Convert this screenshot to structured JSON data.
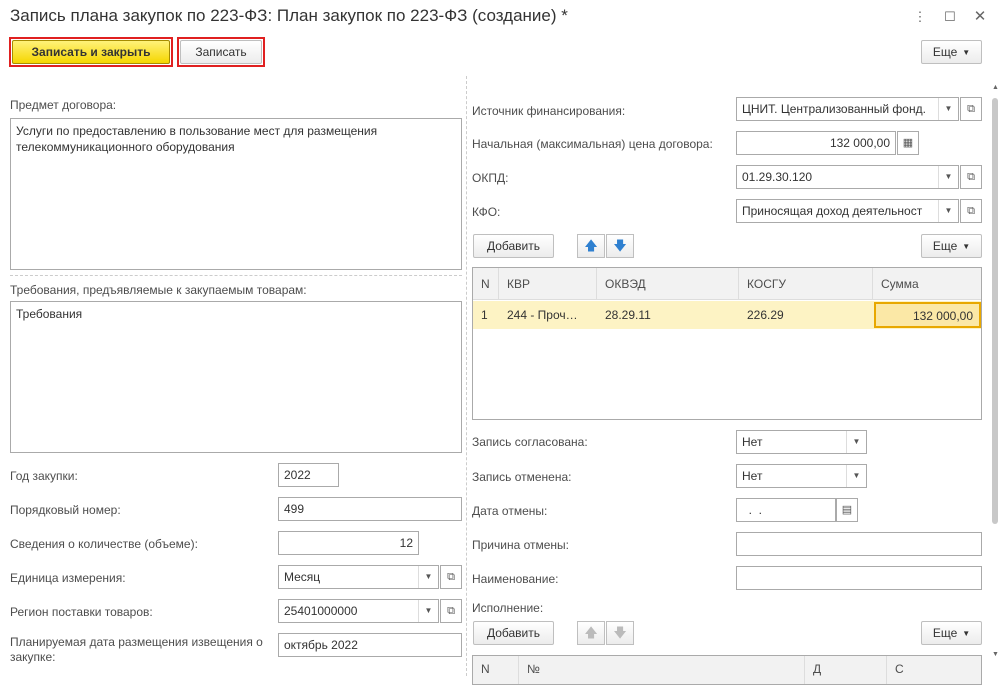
{
  "window": {
    "title": "Запись плана закупок по 223-ФЗ: План закупок по 223-ФЗ (создание) *"
  },
  "toolbar": {
    "save_close": "Записать и закрыть",
    "save": "Записать",
    "more": "Еще"
  },
  "left": {
    "subject_label": "Предмет договора:",
    "subject_value": "Услуги  по предоставлению в пользование мест для размещения телекоммуникационного оборудования",
    "requirements_label": "Требования, предъявляемые к закупаемым товарам:",
    "requirements_value": "Требования",
    "year_label": "Год закупки:",
    "year_value": "2022",
    "order_label": "Порядковый номер:",
    "order_value": "499",
    "quantity_label": "Сведения о количестве (объеме):",
    "quantity_value": "12",
    "unit_label": "Единица измерения:",
    "unit_value": "Месяц",
    "region_label": "Регион поставки товаров:",
    "region_value": "25401000000",
    "notice_date_label": "Планируемая дата размещения извещения о закупке:",
    "notice_date_value": "октябрь 2022"
  },
  "right": {
    "funding_label": "Источник финансирования:",
    "funding_value": "ЦНИТ. Централизованный фонд.",
    "price_label": "Начальная (максимальная) цена договора:",
    "price_value": "132 000,00",
    "okpd_label": "ОКПД:",
    "okpd_value": "01.29.30.120",
    "kfo_label": "КФО:",
    "kfo_value": "Приносящая доход деятельност",
    "add_label": "Добавить",
    "more_label": "Еще",
    "table": {
      "headers": [
        "N",
        "КВР",
        "ОКВЭД",
        "КОСГУ",
        "Сумма"
      ],
      "rows": [
        {
          "n": "1",
          "kvr": "244 - Проч…",
          "okved": "28.29.11",
          "kosgu": "226.29",
          "sum": "132 000,00"
        }
      ]
    },
    "agreed_label": "Запись согласована:",
    "agreed_value": "Нет",
    "cancelled_label": "Запись отменена:",
    "cancelled_value": "Нет",
    "cancel_date_label": "Дата отмены:",
    "cancel_date_value": "  .  .",
    "cancel_reason_label": "Причина отмены:",
    "cancel_reason_value": "",
    "name_label": "Наименование:",
    "name_value": "",
    "execution_label": "Исполнение:",
    "exec_add_label": "Добавить",
    "exec_more_label": "Еще",
    "exec_table_headers": [
      "N",
      "№",
      "Д",
      "С"
    ]
  },
  "icons": {
    "menu": "kebab-icon",
    "restore": "restore-icon",
    "close": "close-icon",
    "dropdown": "chevron-down-icon",
    "open": "open-form-icon",
    "calendar": "calendar-icon",
    "calculator": "calculator-icon",
    "up": "arrow-up-icon",
    "down": "arrow-down-icon"
  },
  "colors": {
    "primary_button": "#f5d600",
    "highlight_frame": "#e02020",
    "selected_row": "#fdf3c4",
    "active_cell_border": "#e8a800",
    "arrow_blue": "#2f80d0"
  }
}
